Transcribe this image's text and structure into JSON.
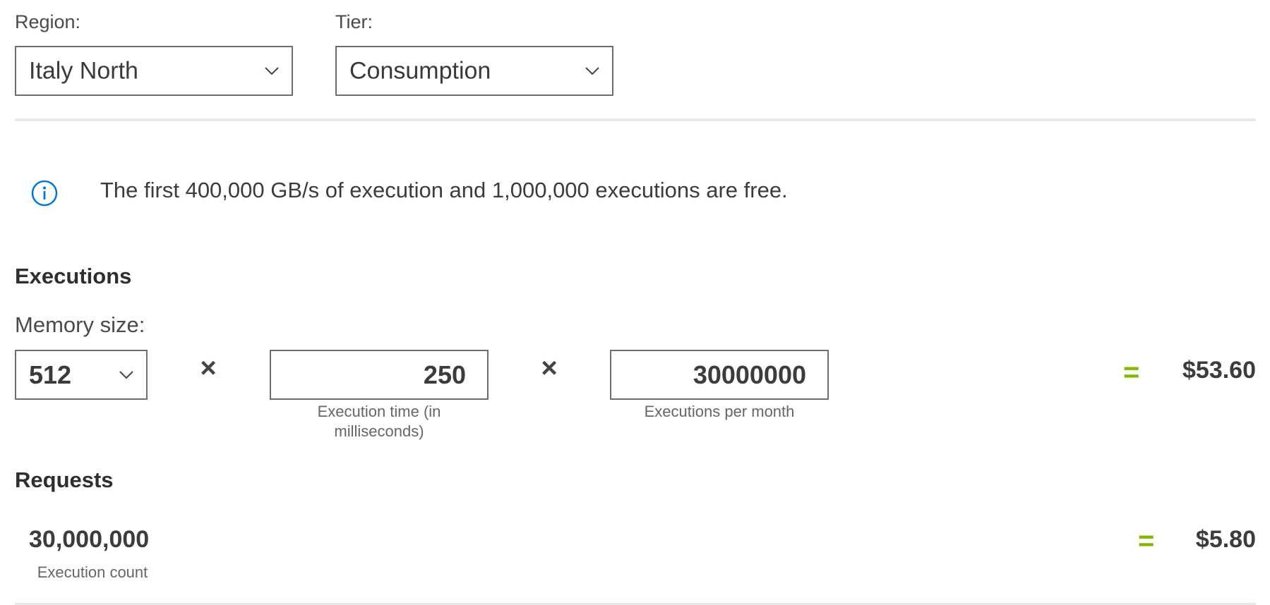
{
  "region": {
    "label": "Region:",
    "selected": "Italy North"
  },
  "tier": {
    "label": "Tier:",
    "selected": "Consumption"
  },
  "info": {
    "text": "The first 400,000 GB/s of execution and 1,000,000 executions are free.",
    "icon": "info-icon",
    "icon_color": "#0078d4"
  },
  "executions": {
    "title": "Executions",
    "memory_label": "Memory size:",
    "memory_selected": "512",
    "operator": "×",
    "execution_time": {
      "value": "250",
      "caption_line1": "Execution time (in",
      "caption_line2": "milliseconds)"
    },
    "executions_per_month": {
      "value": "30000000",
      "caption": "Executions per month"
    },
    "equals": "=",
    "total": "$53.60"
  },
  "requests": {
    "title": "Requests",
    "count": "30,000,000",
    "count_caption": "Execution count",
    "equals": "=",
    "total": "$5.80"
  },
  "colors": {
    "accent_green": "#7fba00",
    "info_blue": "#0078d4",
    "border": "#6e6e6e",
    "divider": "#e8e8e8"
  }
}
